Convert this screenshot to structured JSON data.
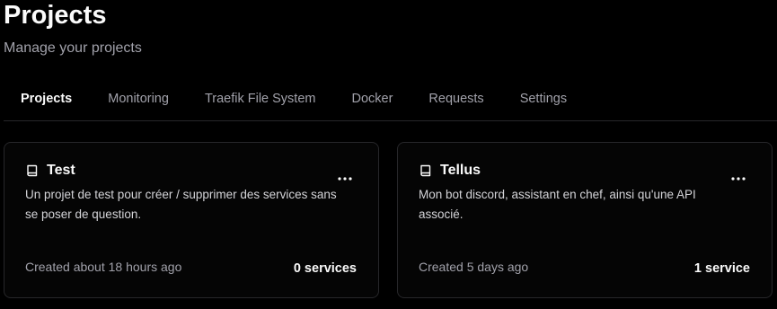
{
  "header": {
    "title": "Projects",
    "subtitle": "Manage your projects"
  },
  "tabs": [
    {
      "label": "Projects",
      "active": true
    },
    {
      "label": "Monitoring",
      "active": false
    },
    {
      "label": "Traefik File System",
      "active": false
    },
    {
      "label": "Docker",
      "active": false
    },
    {
      "label": "Requests",
      "active": false
    },
    {
      "label": "Settings",
      "active": false
    }
  ],
  "projects": [
    {
      "icon": "book-icon",
      "name": "Test",
      "description": "Un projet de test pour créer / supprimer des services sans se poser de question.",
      "created": "Created about 18 hours ago",
      "services": "0 services"
    },
    {
      "icon": "book-icon",
      "name": "Tellus",
      "description": "Mon bot discord, assistant en chef, ainsi qu'une API associé.",
      "created": "Created 5 days ago",
      "services": "1 service"
    }
  ],
  "colors": {
    "background": "#000000",
    "text": "#fafafa",
    "muted": "#a1a1aa",
    "border": "#27272a"
  }
}
